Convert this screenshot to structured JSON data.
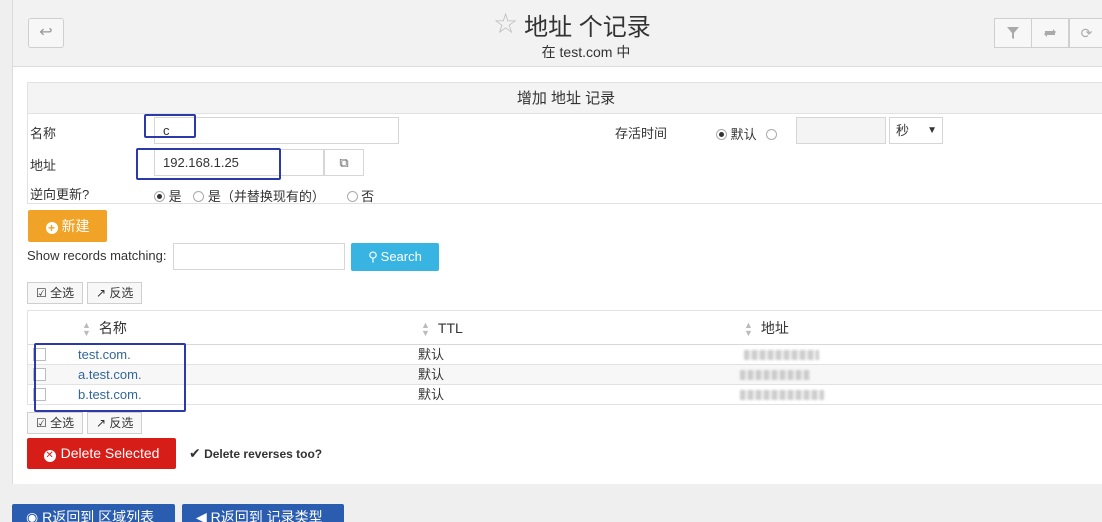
{
  "header": {
    "title": "地址 个记录",
    "subtitle": "在 test.com 中",
    "back_icon": "↩",
    "right_icons": [
      "filter-icon",
      "refresh-icon",
      "sync-icon"
    ]
  },
  "form": {
    "heading": "增加 地址 记录",
    "name_label": "名称",
    "name_value": "c",
    "ttl_label": "存活时间",
    "ttl_default_label": "默认",
    "ttl_unit": "秒",
    "address_label": "地址",
    "address_value": "192.168.1.25",
    "reverse_label": "逆向更新?",
    "reverse_options": [
      "是",
      "是（并替换现有的）",
      "否"
    ],
    "create_button": "新建"
  },
  "search": {
    "label": "Show records matching:",
    "button": "Search"
  },
  "select_all": "全选",
  "invert_select": "反选",
  "table": {
    "headers": [
      "名称",
      "TTL",
      "地址"
    ],
    "rows": [
      {
        "name": "test.com.",
        "ttl": "默认"
      },
      {
        "name": "a.test.com.",
        "ttl": "默认"
      },
      {
        "name": "b.test.com.",
        "ttl": "默认"
      }
    ]
  },
  "delete_button": "Delete Selected",
  "delete_reverses_label": "Delete reverses too?",
  "footer": {
    "back_zones": "R返回到 区域列表",
    "back_types": "R返回到 记录类型"
  },
  "colors": {
    "create_button": "#f0a327",
    "search_button": "#38b4e2",
    "delete_button": "#d71d18",
    "footer_button": "#2a5db0",
    "highlight": "#2b3aa8"
  }
}
